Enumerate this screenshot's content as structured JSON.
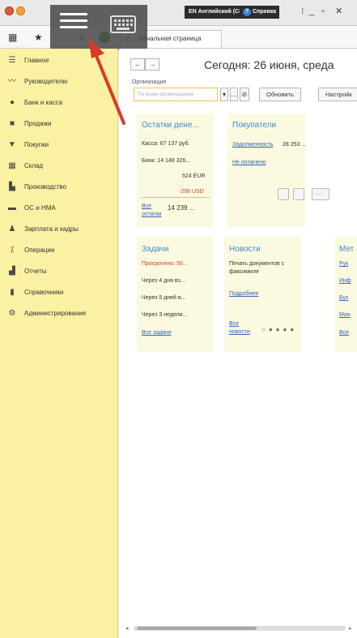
{
  "titlebar": {
    "lang_label": "EN Английский (США)",
    "help_label": "Справка"
  },
  "toolbar": {
    "home_tab_label": "Начальная страница"
  },
  "sidebar": {
    "items": [
      {
        "label": "Главное",
        "icon": "list-icon"
      },
      {
        "label": "Руководителю",
        "icon": "chart-trend-icon"
      },
      {
        "label": "Банк и касса",
        "icon": "bank-icon"
      },
      {
        "label": "Продажи",
        "icon": "bag-icon"
      },
      {
        "label": "Покупки",
        "icon": "cart-icon"
      },
      {
        "label": "Склад",
        "icon": "warehouse-icon"
      },
      {
        "label": "Производство",
        "icon": "factory-icon"
      },
      {
        "label": "ОС и НМА",
        "icon": "truck-icon"
      },
      {
        "label": "Зарплата и кадры",
        "icon": "person-icon"
      },
      {
        "label": "Операции",
        "icon": "operations-icon"
      },
      {
        "label": "Отчеты",
        "icon": "bar-chart-icon"
      },
      {
        "label": "Справочники",
        "icon": "book-icon"
      },
      {
        "label": "Администрирование",
        "icon": "gear-icon"
      }
    ]
  },
  "main": {
    "title": "Сегодня: 26 июня, среда",
    "org_label": "Организация",
    "org_placeholder": "По всем организациям",
    "refresh_label": "Обновить",
    "settings_label": "Настройк"
  },
  "cards": {
    "balances": {
      "title": "Остатки дене...",
      "cash": "Касса:  67 137 руб.",
      "bank": "Банк:  14 148 326...",
      "eur": "524 EUR",
      "usd": "-206 USD",
      "all_link_1": "Все",
      "all_link_2": "остатки",
      "total": "14 239 ..."
    },
    "buyers": {
      "title": "Покупатели",
      "debt_link": "Задолженность",
      "debt_value": "28 253 ...",
      "unpaid_link": "Не оплачено"
    },
    "tasks": {
      "title": "Задачи",
      "overdue": "Просрочено: 50...",
      "in4": "Через 4 дня вз...",
      "in5": "Через 5 дней в...",
      "in3": "Через 3 недели...",
      "all_link": "Все задачи"
    },
    "news": {
      "title": "Новости",
      "text_1": "Печать документов с",
      "text_2": "факсимиле",
      "more_link": "Подробнее",
      "all_link_1": "Все",
      "all_link_2": "новости"
    },
    "methods": {
      "title": "Мет",
      "links": [
        "Рук",
        "Инф",
        "Бух",
        "Мон",
        "Все"
      ]
    }
  },
  "colors": {
    "sidebar_bg": "#fbf1a2",
    "card_bg": "#fbfae0",
    "link": "#2f63b1",
    "title_blue": "#3c8cc4",
    "overdue_red": "#d43c2c",
    "arrow_red": "#d93a2a"
  }
}
